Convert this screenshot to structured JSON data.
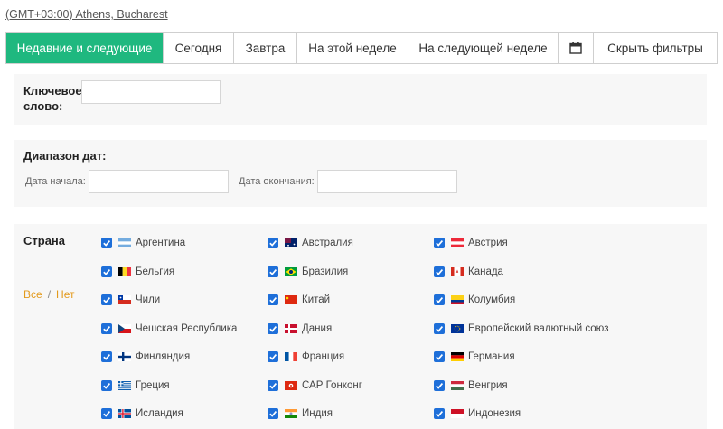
{
  "timezone": "(GMT+03:00) Athens, Bucharest",
  "tabs": [
    {
      "label": "Недавние и следующие"
    },
    {
      "label": "Сегодня"
    },
    {
      "label": "Завтра"
    },
    {
      "label": "На этой неделе"
    },
    {
      "label": "На следующей неделе"
    },
    {
      "label": "calendar-icon"
    },
    {
      "label": "Скрыть фильтры"
    }
  ],
  "keyword": {
    "label": "Ключевое слово:",
    "value": "",
    "placeholder": ""
  },
  "date_range": {
    "label": "Диапазон дат:",
    "start_label": "Дата начала:",
    "end_label": "Дата окончания:",
    "start_value": "",
    "end_value": ""
  },
  "country_filter": {
    "label": "Страна",
    "all": "Все",
    "none": "Нет",
    "countries": [
      {
        "name": "Аргентина",
        "checked": true,
        "flag": "ar"
      },
      {
        "name": "Австралия",
        "checked": true,
        "flag": "au"
      },
      {
        "name": "Австрия",
        "checked": true,
        "flag": "at"
      },
      {
        "name": "Бельгия",
        "checked": true,
        "flag": "be"
      },
      {
        "name": "Бразилия",
        "checked": true,
        "flag": "br"
      },
      {
        "name": "Канада",
        "checked": true,
        "flag": "ca"
      },
      {
        "name": "Чили",
        "checked": true,
        "flag": "cl"
      },
      {
        "name": "Китай",
        "checked": true,
        "flag": "cn"
      },
      {
        "name": "Колумбия",
        "checked": true,
        "flag": "co"
      },
      {
        "name": "Чешская Республика",
        "checked": true,
        "flag": "cz"
      },
      {
        "name": "Дания",
        "checked": true,
        "flag": "dk"
      },
      {
        "name": "Европейский валютный союз",
        "checked": true,
        "flag": "eu"
      },
      {
        "name": "Финляндия",
        "checked": true,
        "flag": "fi"
      },
      {
        "name": "Франция",
        "checked": true,
        "flag": "fr"
      },
      {
        "name": "Германия",
        "checked": true,
        "flag": "de"
      },
      {
        "name": "Греция",
        "checked": true,
        "flag": "gr"
      },
      {
        "name": "САР Гонконг",
        "checked": true,
        "flag": "hk"
      },
      {
        "name": "Венгрия",
        "checked": true,
        "flag": "hu"
      },
      {
        "name": "Исландия",
        "checked": true,
        "flag": "is"
      },
      {
        "name": "Индия",
        "checked": true,
        "flag": "in"
      },
      {
        "name": "Индонезия",
        "checked": true,
        "flag": "id"
      }
    ]
  },
  "colors": {
    "accent": "#1fb87f",
    "checkbox": "#1e6fd9",
    "link_orange": "#e39a1c"
  }
}
